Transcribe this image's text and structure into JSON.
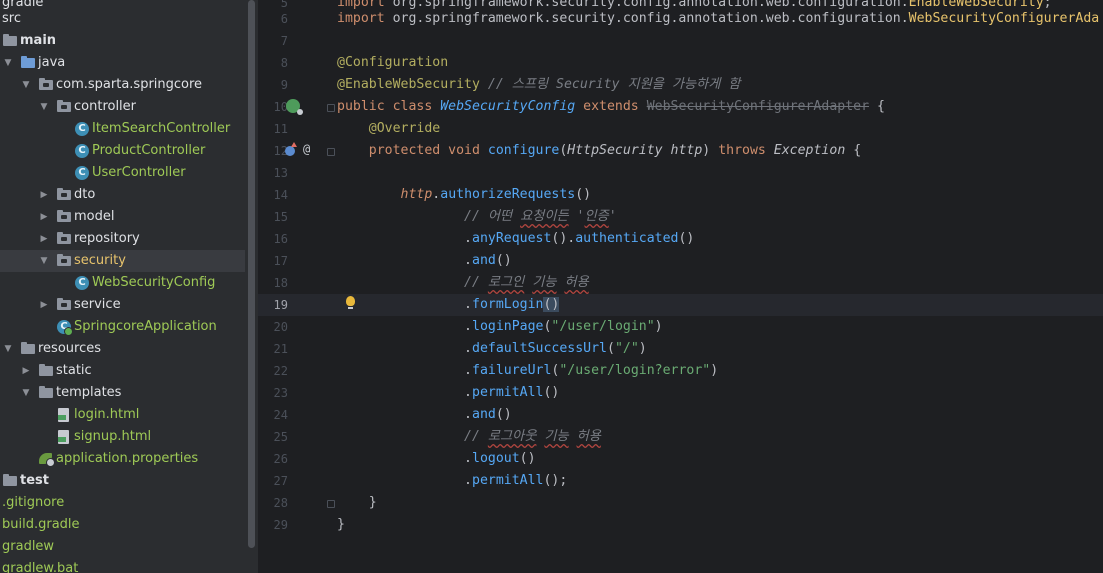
{
  "project_tree": {
    "items": [
      {
        "label": "gradle",
        "icon": "folder-icon",
        "chevron": ""
      },
      {
        "label": "src",
        "icon": "folder-icon",
        "chevron": ""
      },
      {
        "label": "main",
        "icon": "folder-icon",
        "chevron": "expanded"
      },
      {
        "label": "java",
        "icon": "source-folder-icon",
        "chevron": "expanded"
      },
      {
        "label": "com.sparta.springcore",
        "icon": "package-icon",
        "chevron": "expanded"
      },
      {
        "label": "controller",
        "icon": "package-icon",
        "chevron": "expanded"
      },
      {
        "label": "ItemSearchController",
        "icon": "java-class-icon"
      },
      {
        "label": "ProductController",
        "icon": "java-class-icon"
      },
      {
        "label": "UserController",
        "icon": "java-class-icon"
      },
      {
        "label": "dto",
        "icon": "package-icon",
        "chevron": "collapsed"
      },
      {
        "label": "model",
        "icon": "package-icon",
        "chevron": "collapsed"
      },
      {
        "label": "repository",
        "icon": "package-icon",
        "chevron": "collapsed"
      },
      {
        "label": "security",
        "icon": "package-icon",
        "chevron": "expanded",
        "selected": true
      },
      {
        "label": "WebSecurityConfig",
        "icon": "java-class-icon"
      },
      {
        "label": "service",
        "icon": "package-icon",
        "chevron": "collapsed"
      },
      {
        "label": "SpringcoreApplication",
        "icon": "spring-boot-app-icon"
      },
      {
        "label": "resources",
        "icon": "resources-folder-icon",
        "chevron": "expanded"
      },
      {
        "label": "static",
        "icon": "folder-icon",
        "chevron": "collapsed"
      },
      {
        "label": "templates",
        "icon": "folder-icon",
        "chevron": "expanded"
      },
      {
        "label": "login.html",
        "icon": "html-file-icon"
      },
      {
        "label": "signup.html",
        "icon": "html-file-icon"
      },
      {
        "label": "application.properties",
        "icon": "spring-properties-icon"
      },
      {
        "label": "test",
        "icon": "folder-icon",
        "chevron": "collapsed"
      },
      {
        "label": ".gitignore",
        "icon": ""
      },
      {
        "label": "build.gradle",
        "icon": ""
      },
      {
        "label": "gradlew",
        "icon": ""
      },
      {
        "label": "gradlew.bat",
        "icon": ""
      }
    ]
  },
  "editor": {
    "current_line": "19",
    "lines": [
      {
        "num": "5",
        "text": "import org.springframework.security.config.annotation.web.configuration.EnableWebSecurity;"
      },
      {
        "num": "6",
        "text": "import org.springframework.security.config.annotation.web.configuration.WebSecurityConfigurerAda"
      },
      {
        "num": "7",
        "text": ""
      },
      {
        "num": "8",
        "text": "@Configuration"
      },
      {
        "num": "9",
        "text": "@EnableWebSecurity // 스프링 Security 지원을 가능하게 함"
      },
      {
        "num": "10",
        "text": "public class WebSecurityConfig extends WebSecurityConfigurerAdapter {"
      },
      {
        "num": "11",
        "text": "    @Override"
      },
      {
        "num": "12",
        "text": "    protected void configure(HttpSecurity http) throws Exception {"
      },
      {
        "num": "13",
        "text": ""
      },
      {
        "num": "14",
        "text": "        http.authorizeRequests()"
      },
      {
        "num": "15",
        "text": "                // 어떤 요청이든 '인증'"
      },
      {
        "num": "16",
        "text": "                .anyRequest().authenticated()"
      },
      {
        "num": "17",
        "text": "                .and()"
      },
      {
        "num": "18",
        "text": "                // 로그인 기능 허용"
      },
      {
        "num": "19",
        "text": "                .formLogin()"
      },
      {
        "num": "20",
        "text": "                .loginPage(\"/user/login\")"
      },
      {
        "num": "21",
        "text": "                .defaultSuccessUrl(\"/\")"
      },
      {
        "num": "22",
        "text": "                .failureUrl(\"/user/login?error\")"
      },
      {
        "num": "23",
        "text": "                .permitAll()"
      },
      {
        "num": "24",
        "text": "                .and()"
      },
      {
        "num": "25",
        "text": "                // 로그아웃 기능 허용"
      },
      {
        "num": "26",
        "text": "                .logout()"
      },
      {
        "num": "27",
        "text": "                .permitAll();"
      },
      {
        "num": "28",
        "text": "    }"
      },
      {
        "num": "29",
        "text": "}"
      }
    ]
  },
  "colors": {
    "background": "#1e1f22",
    "sidebar": "#2b2d30",
    "keyword": "#cf8e6d",
    "annotation": "#b3ae60",
    "method": "#56a8f5",
    "string": "#6aab73",
    "comment": "#7a7e85",
    "class_ref": "#e7c36c"
  }
}
